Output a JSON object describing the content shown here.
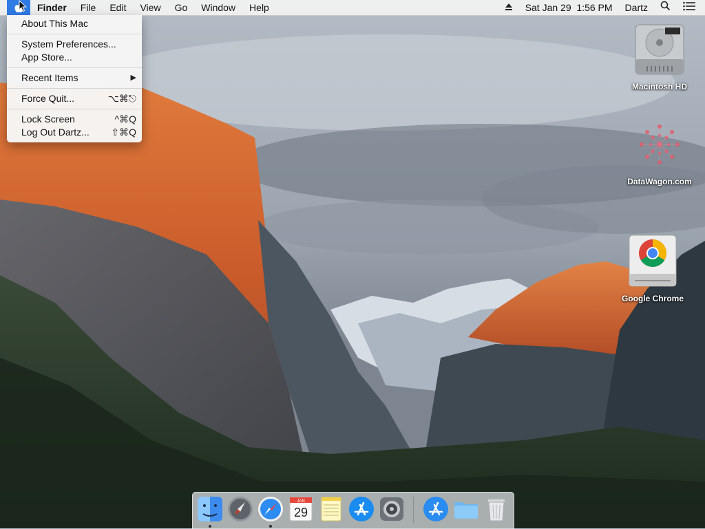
{
  "menubar": {
    "apple_icon": "apple-logo",
    "app_name": "Finder",
    "menus": [
      "File",
      "Edit",
      "View",
      "Go",
      "Window",
      "Help"
    ],
    "right": {
      "eject_icon": "eject-icon",
      "datetime": "Sat Jan 29  1:56 PM",
      "user": "Dartz",
      "search_icon": "spotlight-search-icon",
      "notifications_icon": "notification-center-icon"
    }
  },
  "apple_menu": {
    "groups": [
      [
        {
          "label": "About This Mac",
          "shortcut": ""
        }
      ],
      [
        {
          "label": "System Preferences...",
          "shortcut": ""
        },
        {
          "label": "App Store...",
          "shortcut": ""
        }
      ],
      [
        {
          "label": "Recent Items",
          "shortcut": "▶"
        }
      ],
      [
        {
          "label": "Force Quit...",
          "shortcut": "⌥⌘⎋"
        }
      ],
      [
        {
          "label": "Lock Screen",
          "shortcut": "^⌘Q"
        },
        {
          "label": "Log Out Dartz...",
          "shortcut": "⇧⌘Q"
        }
      ]
    ]
  },
  "desktop_icons": [
    {
      "label": "Macintosh HD",
      "icon": "hard-drive-icon"
    },
    {
      "label": "DataWagon.com",
      "icon": "network-share-icon"
    },
    {
      "label": "Google Chrome",
      "icon": "chrome-disk-image-icon"
    }
  ],
  "dock": {
    "calendar_month": "JAN",
    "calendar_day": "29",
    "apps": [
      {
        "name": "Finder",
        "icon": "finder-icon",
        "running": true
      },
      {
        "name": "Launchpad",
        "icon": "launchpad-icon",
        "running": false
      },
      {
        "name": "Safari",
        "icon": "safari-icon",
        "running": true
      },
      {
        "name": "Calendar",
        "icon": "calendar-icon",
        "running": false
      },
      {
        "name": "Notes",
        "icon": "notes-icon",
        "running": false
      },
      {
        "name": "App Store",
        "icon": "app-store-icon",
        "running": false
      },
      {
        "name": "System Preferences",
        "icon": "system-preferences-icon",
        "running": false
      },
      {
        "name": "Applications",
        "icon": "applications-stack-icon",
        "running": false
      },
      {
        "name": "Downloads",
        "icon": "folder-stack-icon",
        "running": false
      },
      {
        "name": "Trash",
        "icon": "trash-icon",
        "running": false
      }
    ]
  },
  "colors": {
    "menu_highlight": "#2f7be6",
    "cliff_orange": "#d8642e",
    "sky": "#a9b2bc"
  }
}
